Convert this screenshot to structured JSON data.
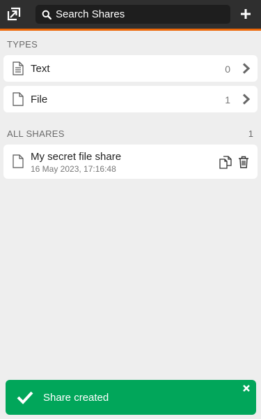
{
  "header": {
    "search_placeholder": "Search Shares"
  },
  "types": {
    "heading": "TYPES",
    "items": [
      {
        "label": "Text",
        "count": "0"
      },
      {
        "label": "File",
        "count": "1"
      }
    ]
  },
  "all_shares": {
    "heading": "ALL SHARES",
    "count": "1",
    "items": [
      {
        "title": "My secret file share",
        "date": "16 May 2023, 17:16:48"
      }
    ]
  },
  "toast": {
    "message": "Share created",
    "color": "#01a65a"
  },
  "colors": {
    "header_bg": "#2f2f2f",
    "accent": "#ec6708"
  },
  "icons": {
    "logo": "share-out-icon",
    "search": "search-icon",
    "add": "plus-icon",
    "text_type": "text-document-icon",
    "file_type": "file-icon",
    "chevron": "chevron-right-icon",
    "copy": "copy-icon",
    "delete": "trash-icon",
    "toast_check": "check-icon",
    "toast_close": "close-icon"
  }
}
